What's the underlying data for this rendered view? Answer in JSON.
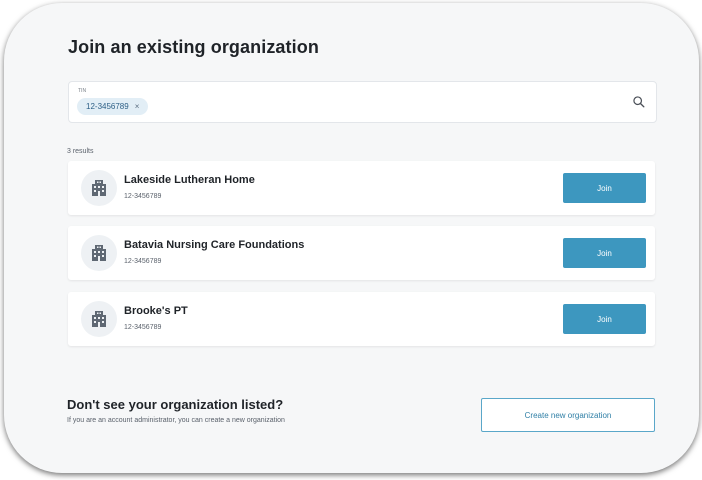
{
  "page": {
    "title": "Join an existing organization"
  },
  "search": {
    "label": "TIN",
    "chip_value": "12-3456789",
    "chip_remove": "×",
    "icon": "search-icon"
  },
  "results": {
    "count_text": "3 results",
    "items": [
      {
        "name": "Lakeside Lutheran Home",
        "tin": "12-3456789",
        "button_label": "Join",
        "icon": "building-icon"
      },
      {
        "name": "Batavia Nursing Care Foundations",
        "tin": "12-3456789",
        "button_label": "Join",
        "icon": "building-icon"
      },
      {
        "name": "Brooke's PT",
        "tin": "12-3456789",
        "button_label": "Join",
        "icon": "building-icon"
      }
    ]
  },
  "footer": {
    "title": "Don't see your organization listed?",
    "subtitle": "If you are an account administrator, you can create a new organization",
    "create_button_label": "Create new organization"
  },
  "colors": {
    "accent": "#3d97bf",
    "chip_bg": "#e2eef6",
    "text_primary": "#1f2328"
  }
}
